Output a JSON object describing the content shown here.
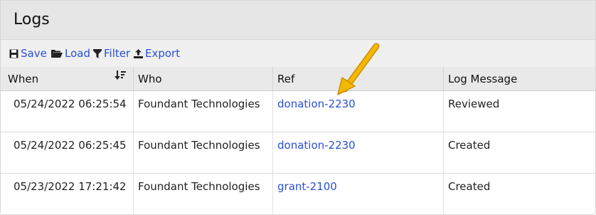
{
  "page": {
    "title": "Logs"
  },
  "toolbar": {
    "save_label": "Save",
    "load_label": "Load",
    "filter_label": "Filter",
    "export_label": "Export",
    "icons": [
      "save-icon",
      "folder-open-icon",
      "filter-icon",
      "export-icon"
    ],
    "link_color": "#2a4fd6"
  },
  "table": {
    "headers": {
      "when": "When",
      "who": "Who",
      "ref": "Ref",
      "message": "Log Message"
    },
    "sort_icon": "sort-descending-icon",
    "rows": [
      {
        "when": "05/24/2022 06:25:54",
        "who": "Foundant Technologies",
        "ref": "donation-2230",
        "message": "Reviewed"
      },
      {
        "when": "05/24/2022 06:25:45",
        "who": "Foundant Technologies",
        "ref": "donation-2230",
        "message": "Created"
      },
      {
        "when": "05/23/2022 17:21:42",
        "who": "Foundant Technologies",
        "ref": "grant-2100",
        "message": "Created"
      }
    ]
  },
  "annotation": {
    "icon": "arrow-annotation-icon",
    "color": "#f5b800"
  }
}
